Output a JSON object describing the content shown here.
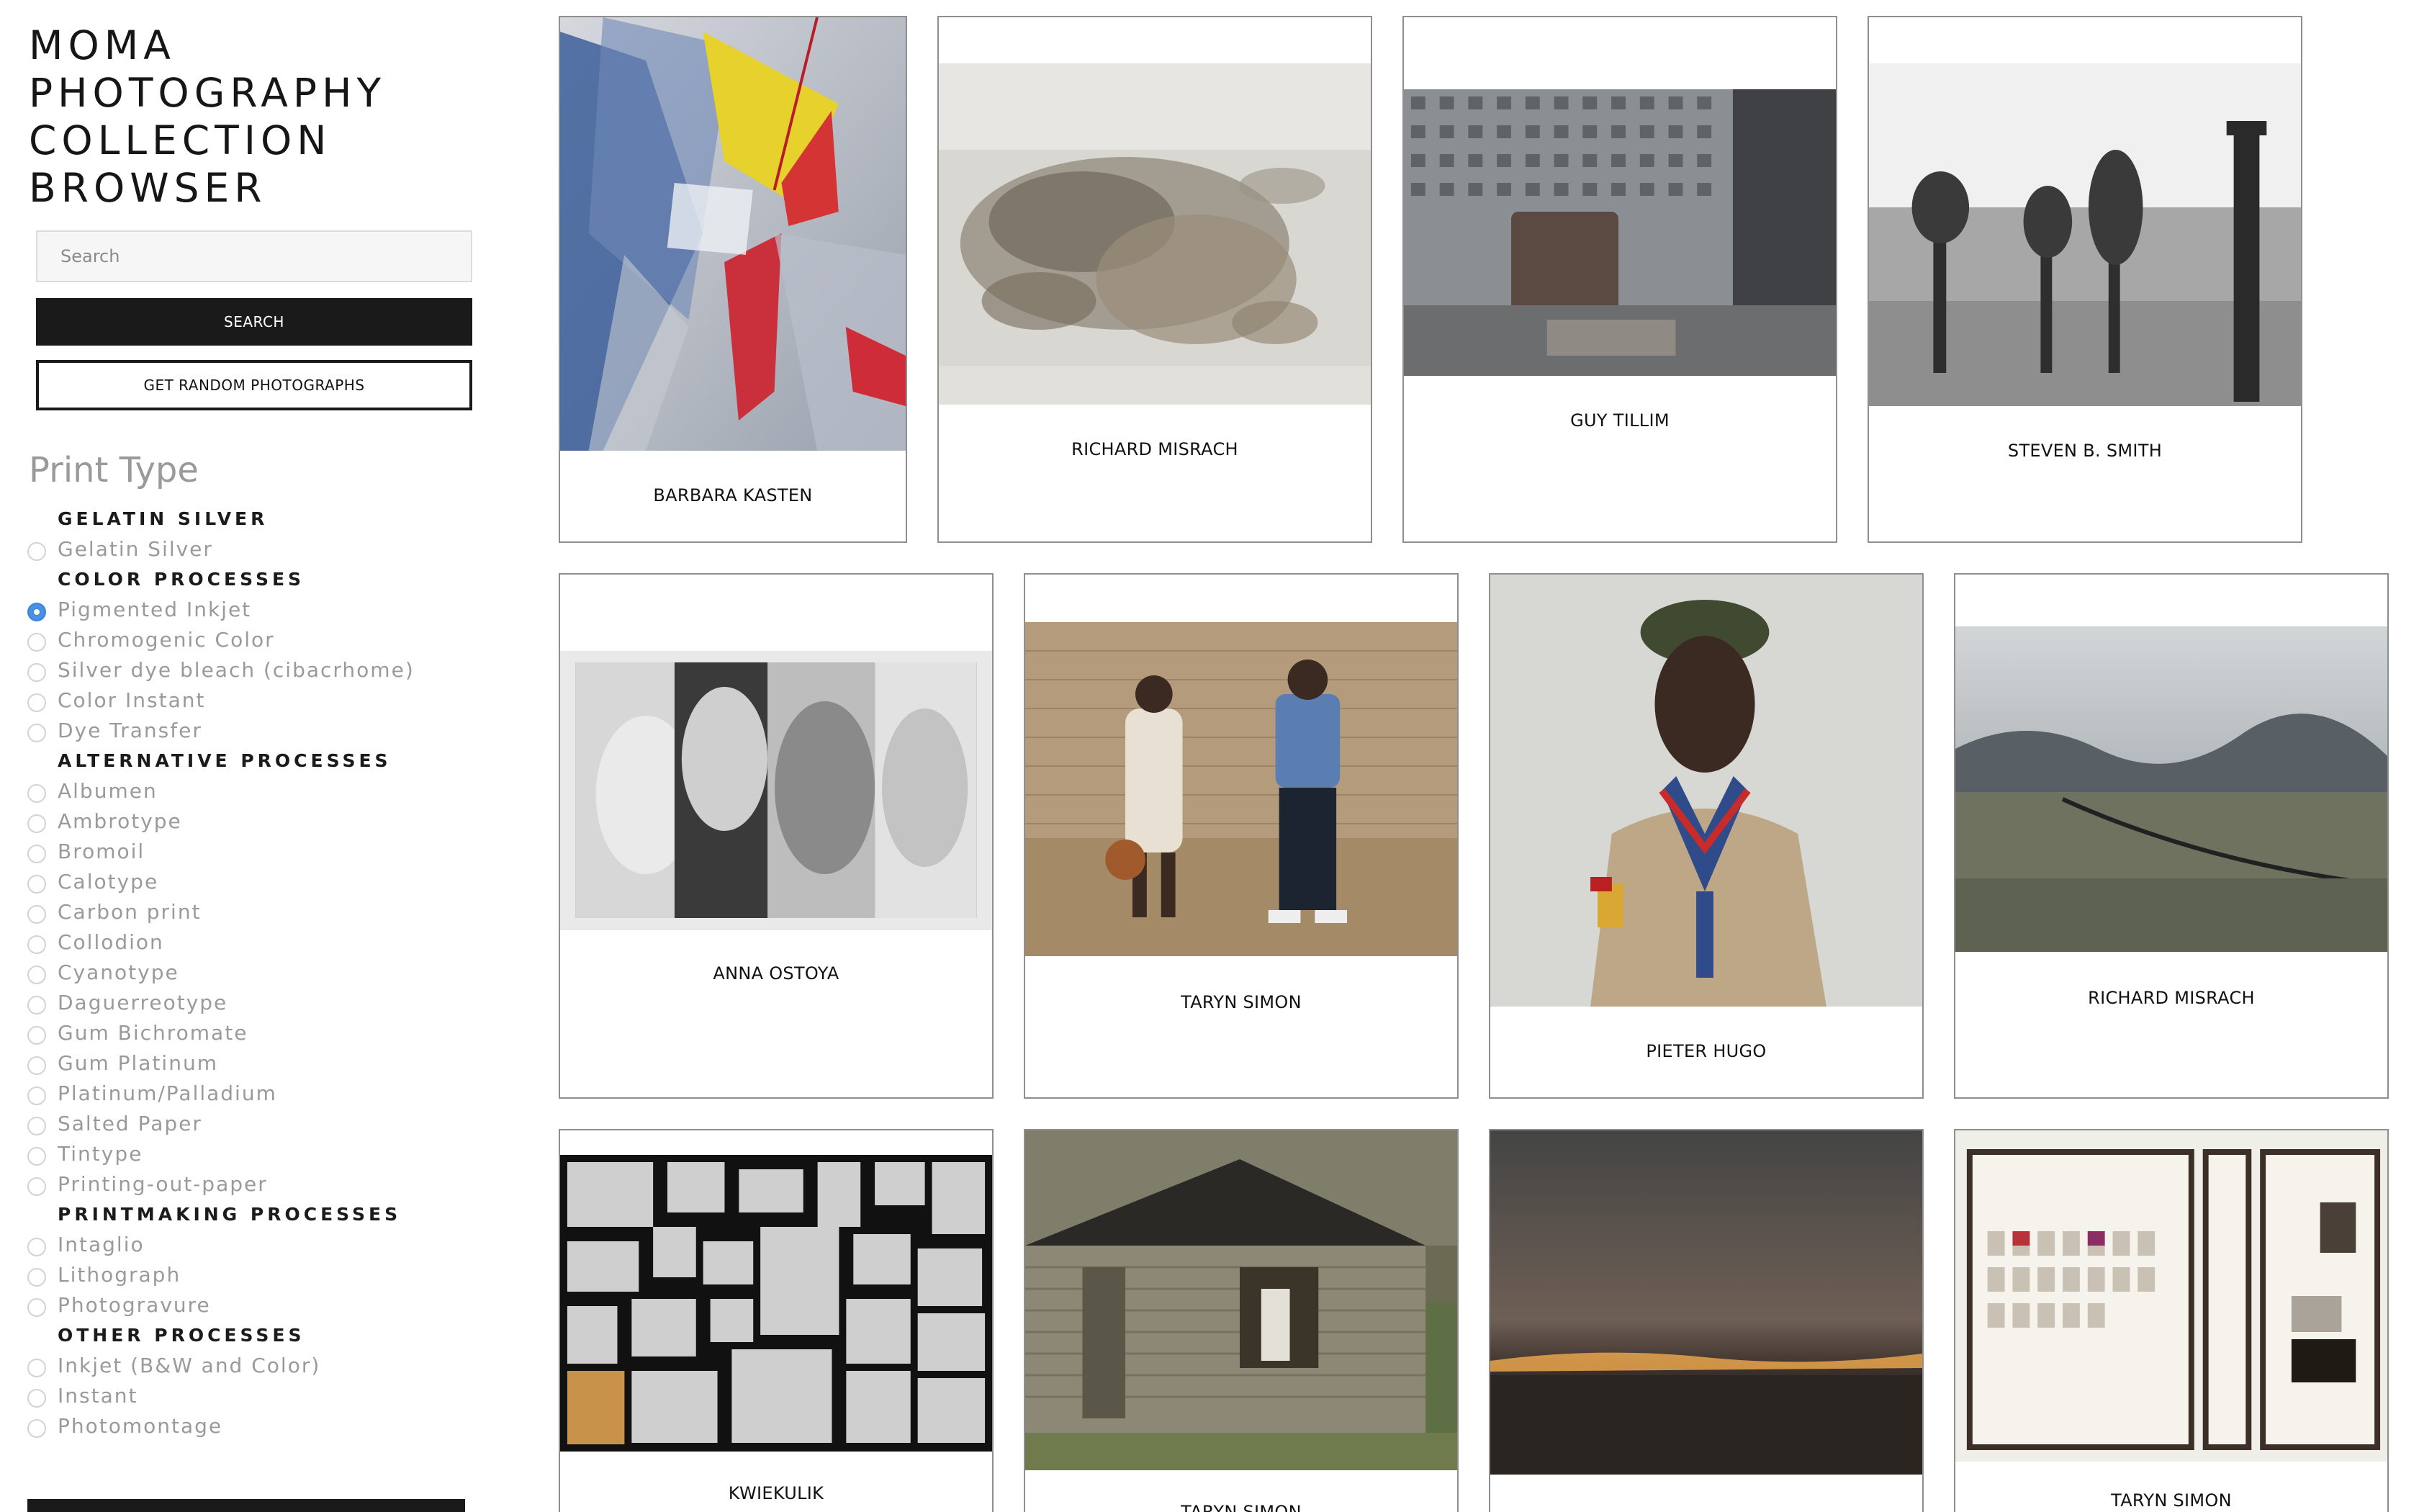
{
  "site": {
    "title_lines": [
      "MOMA",
      "PHOTOGRAPHY",
      "COLLECTION",
      "BROWSER"
    ]
  },
  "search": {
    "placeholder": "Search",
    "value": "",
    "search_button": "SEARCH",
    "random_button": "GET RANDOM PHOTOGRAPHS"
  },
  "filters": {
    "heading": "Print Type",
    "groups": [
      {
        "label": "GELATIN SILVER",
        "options": [
          "Gelatin Silver"
        ]
      },
      {
        "label": "COLOR PROCESSES",
        "options": [
          "Pigmented Inkjet",
          "Chromogenic Color",
          "Silver dye bleach (cibacrhome)",
          "Color Instant",
          "Dye Transfer"
        ]
      },
      {
        "label": "ALTERNATIVE PROCESSES",
        "options": [
          "Albumen",
          "Ambrotype",
          "Bromoil",
          "Calotype",
          "Carbon print",
          "Collodion",
          "Cyanotype",
          "Daguerreotype",
          "Gum Bichromate",
          "Gum Platinum",
          "Platinum/Palladium",
          "Salted Paper",
          "Tintype",
          "Printing-out-paper"
        ]
      },
      {
        "label": "PRINTMAKING PROCESSES",
        "options": [
          "Intaglio",
          "Lithograph",
          "Photogravure"
        ]
      },
      {
        "label": "OTHER PROCESSES",
        "options": [
          "Inkjet (B&W and Color)",
          "Instant",
          "Photomontage"
        ]
      }
    ],
    "selected": "Pigmented Inkjet"
  },
  "photos": [
    {
      "artist": "BARBARA KASTEN"
    },
    {
      "artist": "RICHARD MISRACH"
    },
    {
      "artist": "GUY TILLIM"
    },
    {
      "artist": "STEVEN B. SMITH"
    },
    {
      "artist": "ANNA OSTOYA"
    },
    {
      "artist": "TARYN SIMON"
    },
    {
      "artist": "PIETER HUGO"
    },
    {
      "artist": "RICHARD MISRACH"
    },
    {
      "artist": "KWIEKULIK"
    },
    {
      "artist": "TARYN SIMON"
    },
    {
      "artist": ""
    },
    {
      "artist": "TARYN SIMON"
    }
  ]
}
